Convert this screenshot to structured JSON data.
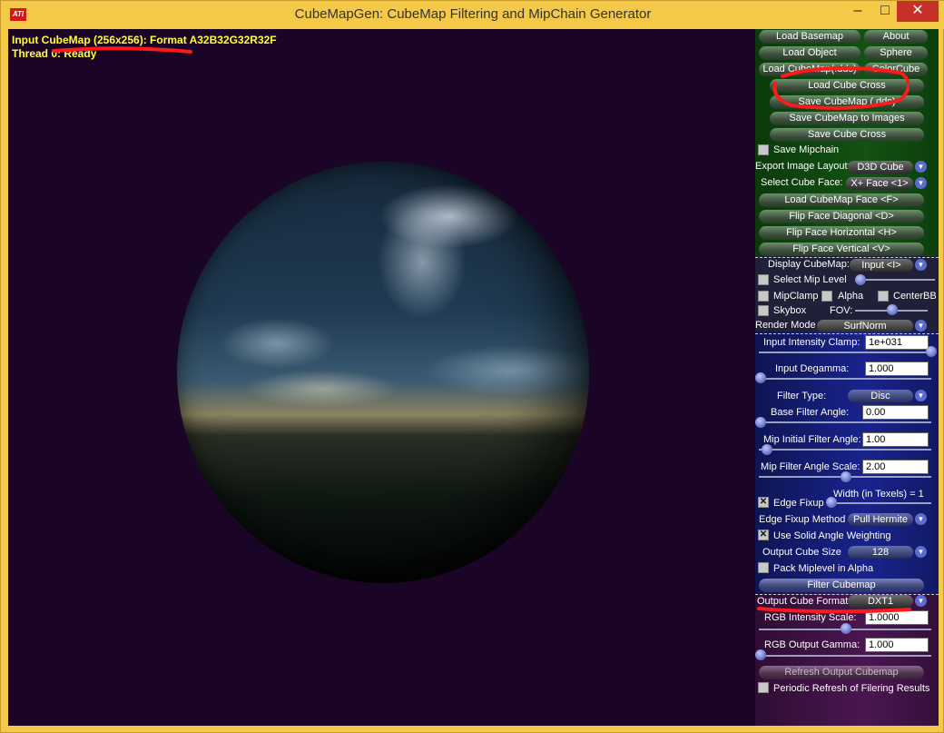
{
  "window": {
    "title": "CubeMapGen: CubeMap Filtering and MipChain Generator",
    "logo": "ATI",
    "minimize_icon": "–",
    "maximize_icon": "□",
    "close_icon": "✕"
  },
  "viewport": {
    "status_line1": "Input CubeMap (256x256): Format A32B32G32R32F",
    "status_line2": "Thread 0: Ready"
  },
  "panel": {
    "load_basemap": "Load Basemap",
    "about": "About",
    "load_object": "Load Object",
    "sphere": "Sphere",
    "load_cubemap_dds": "Load CubeMap(.dds)",
    "color_cube": "ColorCube",
    "load_cube_cross": "Load Cube Cross",
    "save_cubemap_dds": "Save CubeMap (.dds)",
    "save_cubemap_images": "Save CubeMap to Images",
    "save_cube_cross": "Save Cube Cross",
    "save_mipchain": "Save Mipchain",
    "export_layout_label": "Export Image Layout:",
    "export_layout_value": "D3D Cube",
    "select_face_label": "Select Cube Face:",
    "select_face_value": "X+ Face <1>",
    "load_cubemap_face": "Load CubeMap Face  <F>",
    "flip_diagonal": "Flip Face Diagonal  <D>",
    "flip_horizontal": "Flip Face Horizontal  <H>",
    "flip_vertical": "Flip Face Vertical  <V>",
    "display_cubemap_label": "Display CubeMap:",
    "display_cubemap_value": "Input <I>",
    "select_mip_level": "Select Mip Level",
    "mipclamp": "MipClamp",
    "alpha": "Alpha",
    "centerbb": "CenterBB",
    "skybox": "Skybox",
    "fov": "FOV:",
    "render_mode_label": "Render Mode",
    "render_mode_value": "SurfNorm",
    "input_intensity_clamp_label": "Input Intensity Clamp:",
    "input_intensity_clamp_value": "1e+031",
    "input_degamma_label": "Input Degamma:",
    "input_degamma_value": "1.000",
    "filter_type_label": "Filter Type:",
    "filter_type_value": "Disc",
    "base_filter_angle_label": "Base Filter Angle:",
    "base_filter_angle_value": "0.00",
    "mip_initial_filter_angle_label": "Mip Initial Filter Angle:",
    "mip_initial_filter_angle_value": "1.00",
    "mip_filter_angle_scale_label": "Mip Filter Angle Scale:",
    "mip_filter_angle_scale_value": "2.00",
    "width_texels": "Width (in Texels) = 1",
    "edge_fixup": "Edge Fixup",
    "edge_fixup_method_label": "Edge Fixup Method",
    "edge_fixup_method_value": "Pull Hermite",
    "use_solid_angle": "Use Solid Angle Weighting",
    "output_cube_size_label": "Output Cube Size",
    "output_cube_size_value": "128",
    "pack_miplevel": "Pack Miplevel in Alpha",
    "filter_cubemap": "Filter Cubemap",
    "output_cube_format_label": "Output Cube Format",
    "output_cube_format_value": "DXT1",
    "rgb_intensity_scale_label": "RGB Intensity Scale:",
    "rgb_intensity_scale_value": "1.0000",
    "rgb_output_gamma_label": "RGB Output Gamma:",
    "rgb_output_gamma_value": "1.000",
    "refresh_output": "Refresh Output Cubemap",
    "periodic_refresh": "Periodic Refresh of Filering Results",
    "check_mark": "✕",
    "dropdown_arrow": "▼"
  }
}
